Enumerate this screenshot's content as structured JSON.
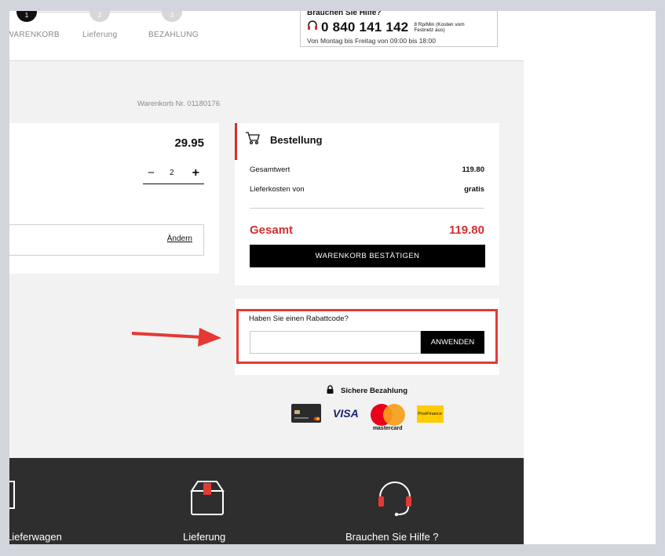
{
  "steps": [
    {
      "number": "1",
      "label": "WARENKORB"
    },
    {
      "number": "2",
      "label": "Lieferung"
    },
    {
      "number": "3",
      "label": "BEZAHLUNG"
    }
  ],
  "help": {
    "title": "Brauchen Sie Hilfe?",
    "phone": "0 840 141 142",
    "cost": "8 Rp/Min (Kosten vom Festnetz aus)",
    "hours": "Von Montag bis Freitag von 09:00 bis 18:00"
  },
  "cart_number": "Warenkorb Nr. 01180176",
  "product": {
    "price": "29.95",
    "minus": "−",
    "quantity": "2",
    "plus": "+",
    "change_link": "Ändern"
  },
  "order": {
    "title": "Bestellung",
    "rows": [
      {
        "label": "Gesamtwert",
        "value": "119.80"
      },
      {
        "label": "Lieferkosten von",
        "value": "gratis"
      }
    ],
    "total_label": "Gesamt",
    "total_value": "119.80",
    "confirm_button": "WARENKORB BESTÄTIGEN"
  },
  "coupon": {
    "question": "Haben Sie einen Rabattcode?",
    "input_value": "",
    "apply_button": "ANWENDEN"
  },
  "secure_payment": "Sichere Bezahlung",
  "payment_methods": {
    "visa": "VISA",
    "mastercard": "mastercard",
    "postfinance": "PostFinance"
  },
  "footer": {
    "items": [
      "Lieferwagen",
      "Lieferung",
      "Brauchen Sie Hilfe ?"
    ]
  },
  "colors": {
    "accent": "#d32f2f",
    "highlight_frame": "#e53935",
    "footer_bg": "#2e2e2e"
  }
}
